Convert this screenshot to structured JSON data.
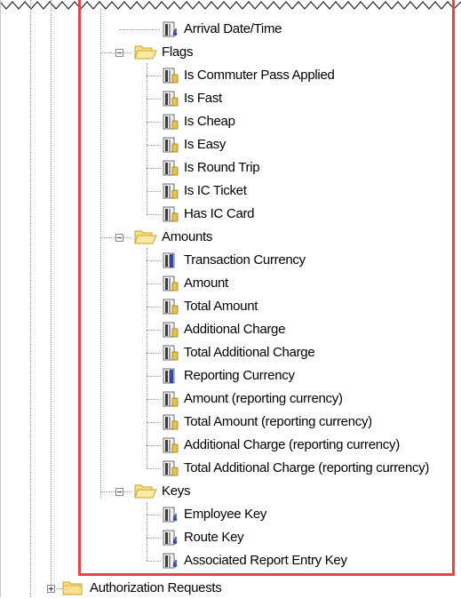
{
  "tree": {
    "top_items": [
      {
        "label": "Arrival Date/Time",
        "icon": "date-field-icon"
      }
    ],
    "groups": [
      {
        "label": "Flags",
        "expanded": true,
        "items": [
          {
            "label": "Is Commuter Pass Applied",
            "icon": "flag-field-icon"
          },
          {
            "label": "Is Fast",
            "icon": "flag-field-icon"
          },
          {
            "label": "Is Cheap",
            "icon": "flag-field-icon"
          },
          {
            "label": "Is Easy",
            "icon": "flag-field-icon"
          },
          {
            "label": "Is Round Trip",
            "icon": "flag-field-icon"
          },
          {
            "label": "Is IC Ticket",
            "icon": "flag-field-icon"
          },
          {
            "label": "Has IC Card",
            "icon": "flag-field-icon"
          }
        ]
      },
      {
        "label": "Amounts",
        "expanded": true,
        "items": [
          {
            "label": "Transaction Currency",
            "icon": "currency-field-icon"
          },
          {
            "label": "Amount",
            "icon": "amount-field-icon"
          },
          {
            "label": "Total Amount",
            "icon": "amount-field-icon"
          },
          {
            "label": "Additional Charge",
            "icon": "amount-field-icon"
          },
          {
            "label": "Total Additional Charge",
            "icon": "amount-field-icon"
          },
          {
            "label": "Reporting Currency",
            "icon": "currency-field-icon"
          },
          {
            "label": "Amount (reporting currency)",
            "icon": "amount-field-icon"
          },
          {
            "label": "Total Amount (reporting currency)",
            "icon": "amount-field-icon"
          },
          {
            "label": "Additional Charge (reporting currency)",
            "icon": "amount-field-icon"
          },
          {
            "label": "Total Additional Charge (reporting currency)",
            "icon": "amount-field-icon"
          }
        ]
      },
      {
        "label": "Keys",
        "expanded": true,
        "items": [
          {
            "label": "Employee Key",
            "icon": "key-field-icon"
          },
          {
            "label": "Route Key",
            "icon": "key-field-icon"
          },
          {
            "label": "Associated Report Entry Key",
            "icon": "key-field-icon"
          }
        ]
      }
    ],
    "bottom_items": [
      {
        "label": "Authorization Requests",
        "icon": "folder-icon",
        "expanded": false
      }
    ]
  },
  "colors": {
    "highlight_frame": "#e0464a",
    "folder_fill": "#f7e08a",
    "folder_stroke": "#c9a227",
    "field_icon_blue": "#2c4aa8"
  }
}
